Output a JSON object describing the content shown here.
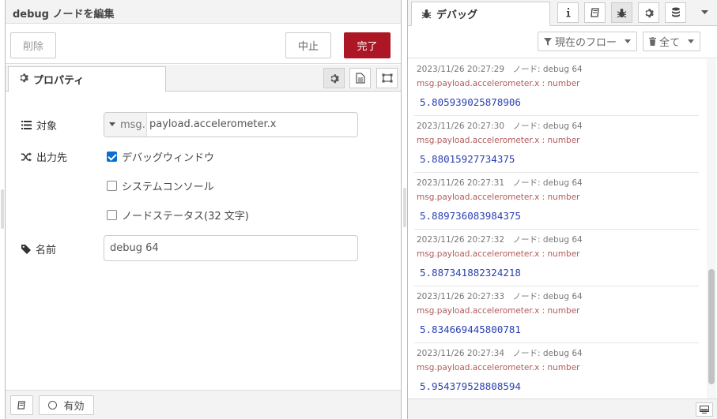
{
  "tray": {
    "title": "debug ノードを編集",
    "delete_label": "削除",
    "cancel_label": "中止",
    "done_label": "完了",
    "tab_properties": "プロパティ",
    "fields": {
      "target_label": "対象",
      "target_prefix": "msg.",
      "target_value": "payload.accelerometer.x",
      "output_label": "出力先",
      "opt_debug_window": "デバッグウィンドウ",
      "opt_debug_window_checked": true,
      "opt_system_console": "システムコンソール",
      "opt_system_console_checked": false,
      "opt_node_status": "ノードステータス(32 文字)",
      "opt_node_status_checked": false,
      "name_label": "名前",
      "name_value": "debug 64"
    },
    "footer_enabled": "有効"
  },
  "sidebar": {
    "tab_label": "デバッグ",
    "filter_flow": "現在のフロー",
    "filter_clear": "全て",
    "messages": [
      {
        "meta": "2023/11/26 20:27:29　ノード: debug 64",
        "path": "msg.payload.accelerometer.x : number",
        "value": "5.805939025878906"
      },
      {
        "meta": "2023/11/26 20:27:30　ノード: debug 64",
        "path": "msg.payload.accelerometer.x : number",
        "value": "5.88015927734375"
      },
      {
        "meta": "2023/11/26 20:27:31　ノード: debug 64",
        "path": "msg.payload.accelerometer.x : number",
        "value": "5.889736083984375"
      },
      {
        "meta": "2023/11/26 20:27:32　ノード: debug 64",
        "path": "msg.payload.accelerometer.x : number",
        "value": "5.887341882324218"
      },
      {
        "meta": "2023/11/26 20:27:33　ノード: debug 64",
        "path": "msg.payload.accelerometer.x : number",
        "value": "5.834669445800781"
      },
      {
        "meta": "2023/11/26 20:27:34　ノード: debug 64",
        "path": "msg.payload.accelerometer.x : number",
        "value": "5.954379528808594"
      }
    ]
  },
  "colors": {
    "done_button": "#ad1625",
    "value_text": "#2a3fb0",
    "path_text": "#b25b5b"
  }
}
